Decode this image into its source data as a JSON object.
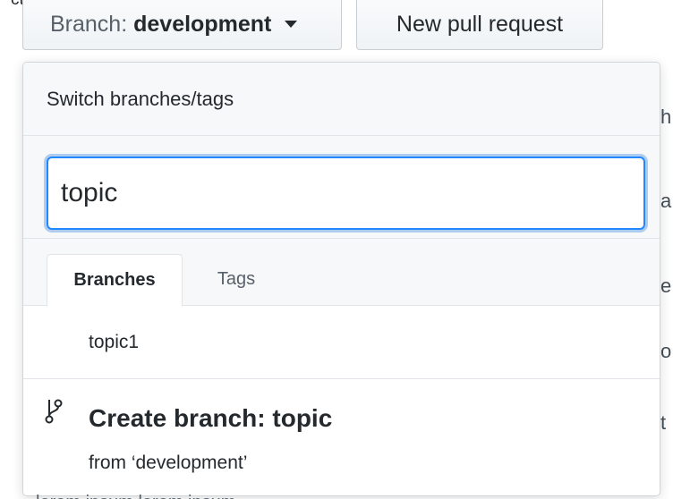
{
  "toolbar": {
    "branch_prefix": "Branch:",
    "branch_name": "development",
    "new_pr_label": "New pull request"
  },
  "dropdown": {
    "header": "Switch branches/tags",
    "filter_value": "topic",
    "tabs": [
      {
        "label": "Branches",
        "selected": true
      },
      {
        "label": "Tags",
        "selected": false
      }
    ],
    "branches": [
      "topic1"
    ],
    "create": {
      "title": "Create branch: topic",
      "subtitle": "from ‘development’"
    }
  },
  "colors": {
    "focus_ring": "#2188ff",
    "header_bg": "#f6f8fa",
    "border": "#e1e4e8"
  }
}
